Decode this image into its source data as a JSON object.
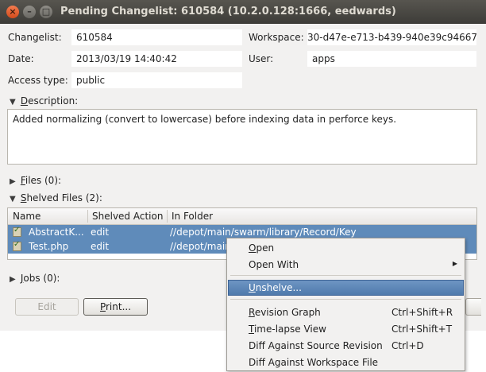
{
  "window": {
    "title": "Pending Changelist: 610584 (10.2.0.128:1666,  eedwards)",
    "close_glyph": "×",
    "minimize_glyph": "–",
    "maximize_glyph": "□"
  },
  "form": {
    "changelist_label": "Changelist:",
    "changelist_value": "610584",
    "workspace_label": "Workspace:",
    "workspace_value": "30-d47e-e713-b439-940e39c94667",
    "date_label": "Date:",
    "date_value": "2013/03/19 14:40:42",
    "user_label": "User:",
    "user_value": "apps",
    "access_label": "Access type:",
    "access_value": "public"
  },
  "description": {
    "label_first": "D",
    "label_rest": "escription:",
    "text": "Added normalizing (convert to lowercase) before indexing data in perforce keys."
  },
  "files": {
    "label_first": "F",
    "label_rest": "iles",
    "count": "(0):"
  },
  "shelved": {
    "label_first": "S",
    "label_rest": "helved Files",
    "count": "(2):",
    "columns": [
      "Name",
      "Shelved Action",
      "In Folder"
    ],
    "rows": [
      {
        "name": "AbstractK...",
        "action": "edit",
        "folder": "//depot/main/swarm/library/Record/Key"
      },
      {
        "name": "Test.php",
        "action": "edit",
        "folder": "//depot/main/swarm/library/Record/Key"
      }
    ]
  },
  "jobs": {
    "label_first": "J",
    "label_rest": "obs",
    "count": "(0):"
  },
  "buttons": {
    "edit": "Edit",
    "print_first": "P",
    "print_rest": "rint..."
  },
  "context_menu": {
    "items": [
      {
        "first": "O",
        "rest": "pen",
        "shortcut": ""
      },
      {
        "first": "",
        "rest": "Open With",
        "shortcut": "",
        "submenu": "▶"
      },
      {
        "first": "U",
        "rest": "nshelve...",
        "shortcut": ""
      },
      {
        "first": "R",
        "rest": "evision Graph",
        "shortcut": "Ctrl+Shift+R"
      },
      {
        "first": "T",
        "rest": "ime-lapse View",
        "shortcut": "Ctrl+Shift+T"
      },
      {
        "first": "",
        "rest": "Diff Against Source Revision",
        "shortcut": "Ctrl+D"
      },
      {
        "first": "",
        "rest": "Diff Against Workspace File",
        "shortcut": ""
      }
    ]
  },
  "icons": {
    "expand": "▶",
    "collapse": "▼"
  },
  "colors": {
    "selection": "#5f8bba",
    "menu_highlight": "#5a84b6",
    "titlebar": "#4a4844"
  }
}
